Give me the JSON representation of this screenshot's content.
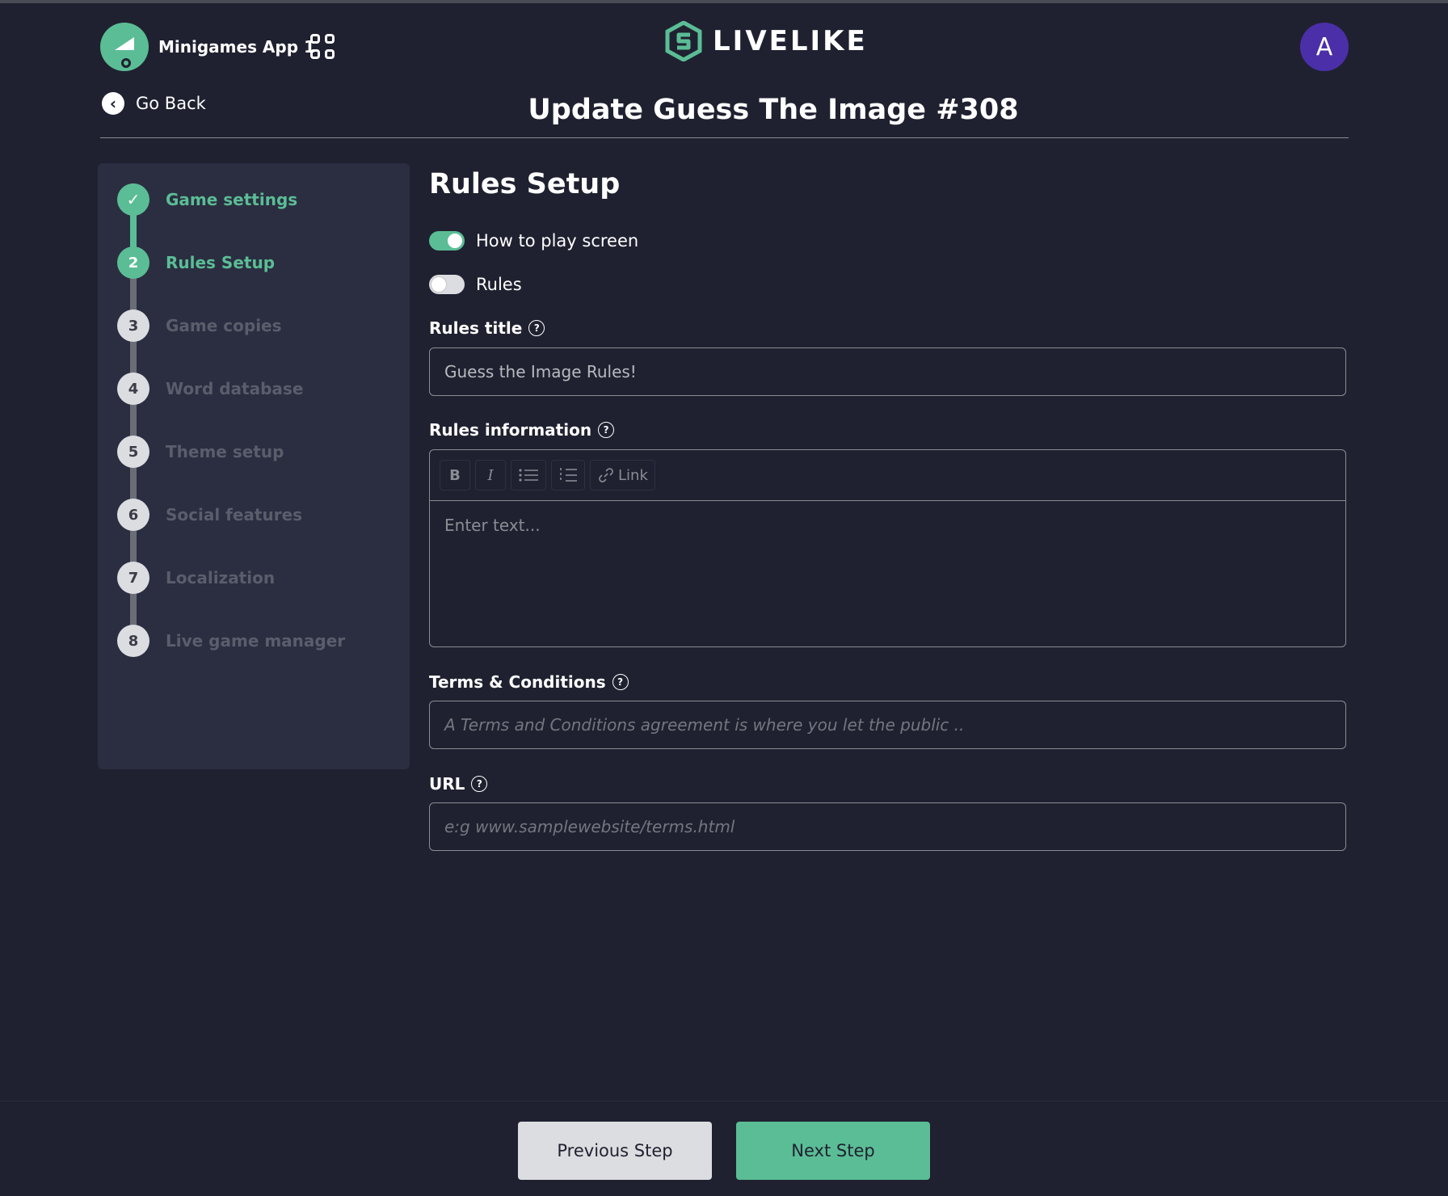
{
  "header": {
    "app_name": "Minigames App 1",
    "brand": "LIVELIKE",
    "avatar_initial": "A",
    "go_back": "Go Back",
    "page_title": "Update Guess The Image #308"
  },
  "sidebar": {
    "steps": [
      {
        "number": "✓",
        "label": "Game settings",
        "state": "done"
      },
      {
        "number": "2",
        "label": "Rules Setup",
        "state": "active"
      },
      {
        "number": "3",
        "label": "Game copies",
        "state": "pending"
      },
      {
        "number": "4",
        "label": "Word database",
        "state": "pending"
      },
      {
        "number": "5",
        "label": "Theme setup",
        "state": "pending"
      },
      {
        "number": "6",
        "label": "Social features",
        "state": "pending"
      },
      {
        "number": "7",
        "label": "Localization",
        "state": "pending"
      },
      {
        "number": "8",
        "label": "Live game manager",
        "state": "pending"
      }
    ]
  },
  "main": {
    "section_title": "Rules Setup",
    "toggles": {
      "how_to_play": {
        "label": "How to play screen",
        "on": true
      },
      "rules": {
        "label": "Rules",
        "on": false
      }
    },
    "rules_title": {
      "label": "Rules title",
      "value": "Guess the Image Rules!"
    },
    "rules_information": {
      "label": "Rules information",
      "toolbar": {
        "bold": "B",
        "italic": "I",
        "link": "Link"
      },
      "placeholder": "Enter text..."
    },
    "terms": {
      "label": "Terms & Conditions",
      "placeholder": "A Terms and Conditions agreement is where you let the public .."
    },
    "url": {
      "label": "URL",
      "placeholder": "e:g www.samplewebsite/terms.html"
    },
    "help_glyph": "?"
  },
  "footer": {
    "previous": "Previous Step",
    "next": "Next Step"
  },
  "colors": {
    "background": "#1f2130",
    "panel": "#2b2e41",
    "accent": "#5bbd95",
    "avatar": "#4b2fa8"
  }
}
